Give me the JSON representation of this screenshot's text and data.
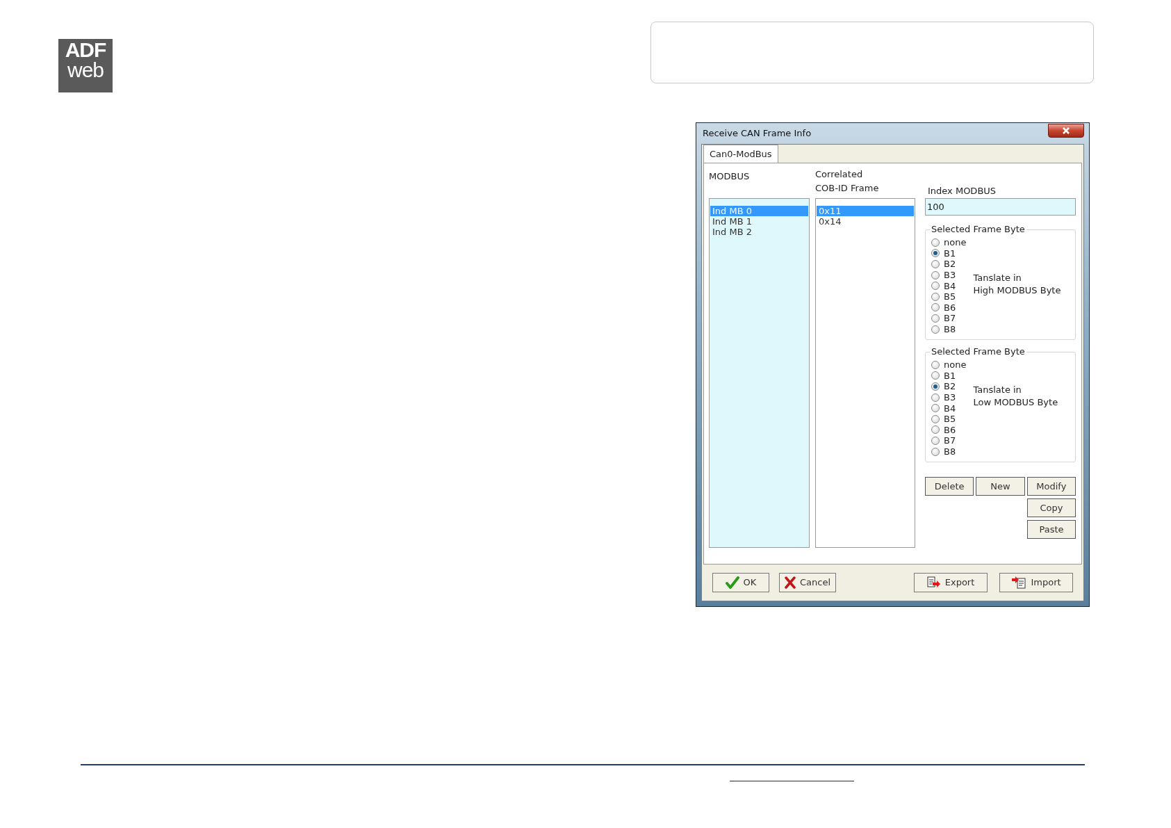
{
  "logo": {
    "top": "ADF",
    "bottom": "web"
  },
  "dialog": {
    "title": "Receive CAN Frame Info",
    "tabs": [
      {
        "label": "Can0-ModBus",
        "selected": true
      }
    ],
    "modbus": {
      "label": "MODBUS",
      "items": [
        {
          "label": "Ind MB 0",
          "selected": true
        },
        {
          "label": "Ind MB 1",
          "selected": false
        },
        {
          "label": "Ind MB 2",
          "selected": false
        }
      ]
    },
    "cobid": {
      "label_lines": [
        "Correlated",
        "COB-ID Frame"
      ],
      "items": [
        {
          "label": "0x11",
          "selected": true
        },
        {
          "label": "0x14",
          "selected": false
        }
      ]
    },
    "index": {
      "label": "Index MODBUS",
      "value": "100"
    },
    "groups": [
      {
        "title": "Selected Frame Byte",
        "caption_lines": [
          "Tanslate in",
          "High MODBUS Byte"
        ],
        "options": [
          {
            "label": "none",
            "selected": false
          },
          {
            "label": "B1",
            "selected": true
          },
          {
            "label": "B2",
            "selected": false
          },
          {
            "label": "B3",
            "selected": false
          },
          {
            "label": "B4",
            "selected": false
          },
          {
            "label": "B5",
            "selected": false
          },
          {
            "label": "B6",
            "selected": false
          },
          {
            "label": "B7",
            "selected": false
          },
          {
            "label": "B8",
            "selected": false
          }
        ]
      },
      {
        "title": "Selected Frame Byte",
        "caption_lines": [
          "Tanslate in",
          "Low MODBUS Byte"
        ],
        "options": [
          {
            "label": "none",
            "selected": false
          },
          {
            "label": "B1",
            "selected": false
          },
          {
            "label": "B2",
            "selected": true
          },
          {
            "label": "B3",
            "selected": false
          },
          {
            "label": "B4",
            "selected": false
          },
          {
            "label": "B5",
            "selected": false
          },
          {
            "label": "B6",
            "selected": false
          },
          {
            "label": "B7",
            "selected": false
          },
          {
            "label": "B8",
            "selected": false
          }
        ]
      }
    ],
    "action_rows": [
      [
        {
          "label": "Delete"
        },
        {
          "label": "New"
        },
        {
          "label": "Modify"
        }
      ],
      [
        {
          "label": "Copy"
        }
      ],
      [
        {
          "label": "Paste"
        }
      ]
    ],
    "footer_buttons": [
      {
        "label": "OK",
        "kind": "ok"
      },
      {
        "label": "Cancel",
        "kind": "cancel"
      },
      {
        "label": "Export",
        "kind": "export"
      },
      {
        "label": "Import",
        "kind": "import"
      }
    ]
  }
}
